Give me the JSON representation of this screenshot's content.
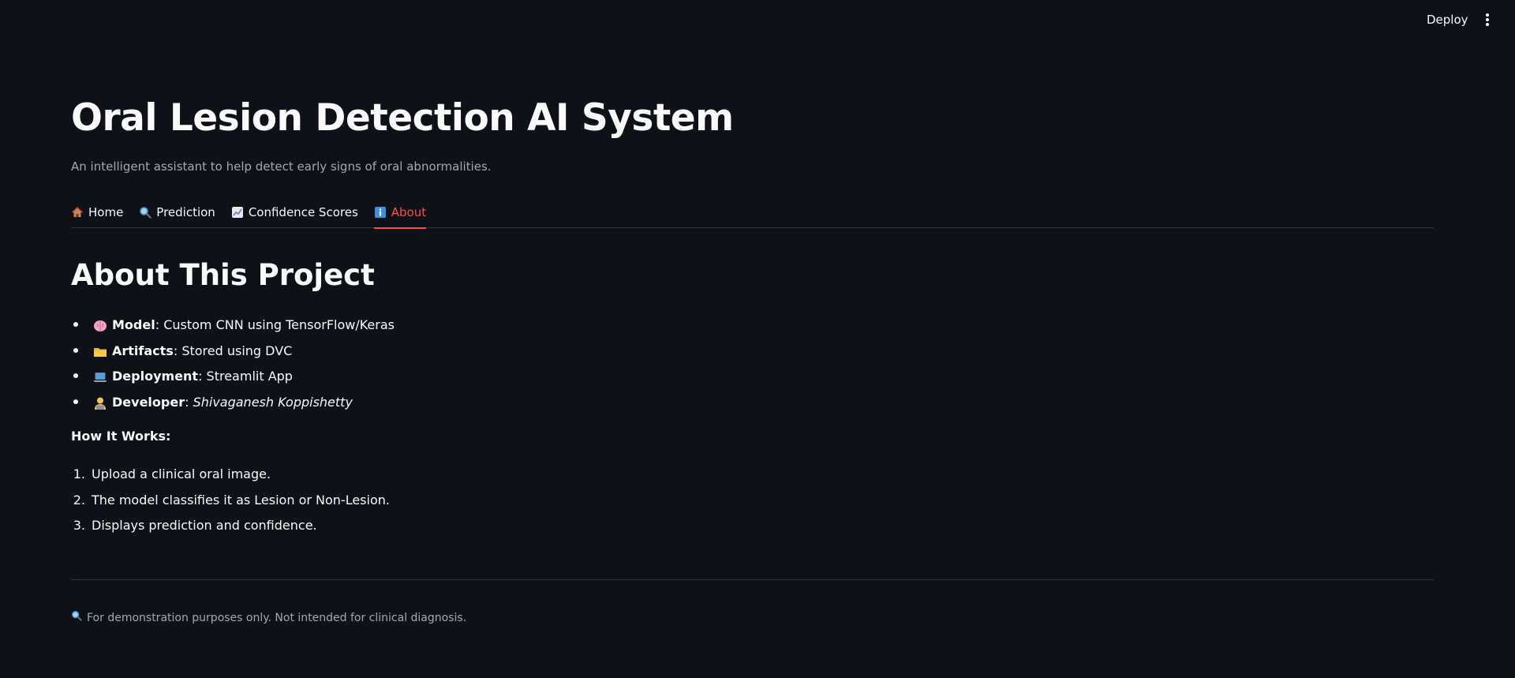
{
  "header": {
    "deploy_label": "Deploy",
    "menu_icon": "vertical-ellipsis-icon"
  },
  "page": {
    "title": "Oral Lesion Detection AI System",
    "subtitle": "An intelligent assistant to help detect early signs of oral abnormalities."
  },
  "tabs": [
    {
      "icon": "house-icon",
      "label": "Home",
      "active": false
    },
    {
      "icon": "magnifier-icon",
      "label": "Prediction",
      "active": false
    },
    {
      "icon": "chart-icon",
      "label": "Confidence Scores",
      "active": false
    },
    {
      "icon": "info-icon",
      "label": "About",
      "active": true
    }
  ],
  "about": {
    "title": "About This Project",
    "features": [
      {
        "icon": "brain-icon",
        "label": "Model",
        "separator": ":",
        "value": "Custom CNN using TensorFlow/Keras"
      },
      {
        "icon": "folder-icon",
        "label": "Artifacts",
        "separator": ":",
        "value": "Stored using DVC"
      },
      {
        "icon": "laptop-icon",
        "label": "Deployment",
        "separator": ":",
        "value": "Streamlit App"
      },
      {
        "icon": "developer-icon",
        "label": "Developer",
        "separator": ":",
        "value": "Shivaganesh Koppishetty"
      }
    ],
    "how_title": "How It Works:",
    "steps": [
      {
        "num": "1.",
        "text": "Upload a clinical oral image."
      },
      {
        "num": "2.",
        "text": "The model classifies it as Lesion or Non-Lesion."
      },
      {
        "num": "3.",
        "text": "Displays prediction and confidence."
      }
    ]
  },
  "footer": {
    "icon": "magnifier-icon",
    "disclaimer": "For demonstration purposes only. Not intended for clinical diagnosis."
  },
  "colors": {
    "background": "#0e1117",
    "text": "#fafafa",
    "muted": "#a3a8b4",
    "accent": "#ff4b4b",
    "divider": "#31333f"
  }
}
